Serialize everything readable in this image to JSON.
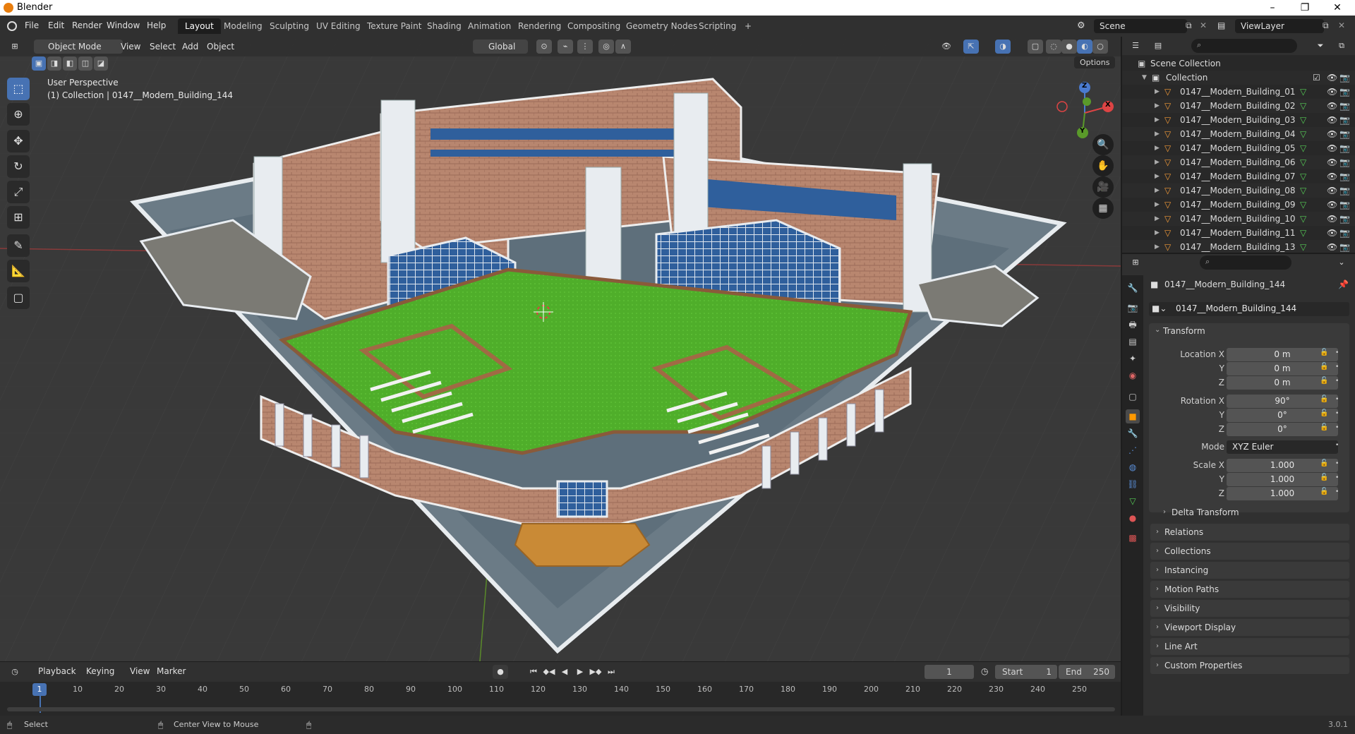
{
  "app": {
    "title": "Blender",
    "version": "3.0.1"
  },
  "menus": [
    "File",
    "Edit",
    "Render",
    "Window",
    "Help"
  ],
  "workspaces": [
    "Layout",
    "Modeling",
    "Sculpting",
    "UV Editing",
    "Texture Paint",
    "Shading",
    "Animation",
    "Rendering",
    "Compositing",
    "Geometry Nodes",
    "Scripting",
    "+"
  ],
  "active_workspace": "Layout",
  "scene": {
    "name": "Scene",
    "view_layer": "ViewLayer"
  },
  "viewport": {
    "mode": "Object Mode",
    "menus": [
      "View",
      "Select",
      "Add",
      "Object"
    ],
    "orientation": "Global",
    "options_label": "Options",
    "overlay_title": "User Perspective",
    "overlay_subtitle": "(1) Collection | 0147__Modern_Building_144",
    "axes": {
      "x": "X",
      "y": "Y",
      "z": "Z"
    }
  },
  "outliner": {
    "scene_collection": "Scene Collection",
    "collection": "Collection",
    "items": [
      "0147__Modern_Building_01",
      "0147__Modern_Building_02",
      "0147__Modern_Building_03",
      "0147__Modern_Building_04",
      "0147__Modern_Building_05",
      "0147__Modern_Building_06",
      "0147__Modern_Building_07",
      "0147__Modern_Building_08",
      "0147__Modern_Building_09",
      "0147__Modern_Building_10",
      "0147__Modern_Building_11",
      "0147__Modern_Building_13"
    ]
  },
  "properties": {
    "object_name": "0147__Modern_Building_144",
    "object_field": "0147__Modern_Building_144",
    "transform_label": "Transform",
    "location": {
      "label": "Location X",
      "x": "0 m",
      "y": "0 m",
      "z": "0 m"
    },
    "rotation": {
      "label": "Rotation X",
      "x": "90°",
      "y": "0°",
      "z": "0°"
    },
    "mode": {
      "label": "Mode",
      "value": "XYZ Euler"
    },
    "scale": {
      "label": "Scale X",
      "x": "1.000",
      "y": "1.000",
      "z": "1.000"
    },
    "axis_y": "Y",
    "axis_z": "Z",
    "delta_transform": "Delta Transform",
    "panels": [
      "Relations",
      "Collections",
      "Instancing",
      "Motion Paths",
      "Visibility",
      "Viewport Display",
      "Line Art",
      "Custom Properties"
    ]
  },
  "timeline": {
    "menus": [
      "Playback",
      "Keying",
      "View",
      "Marker"
    ],
    "current_frame": "1",
    "start_label": "Start",
    "start": "1",
    "end_label": "End",
    "end": "250",
    "ruler": [
      "10",
      "20",
      "30",
      "40",
      "50",
      "60",
      "70",
      "80",
      "90",
      "100",
      "110",
      "120",
      "130",
      "140",
      "150",
      "160",
      "170",
      "180",
      "190",
      "200",
      "210",
      "220",
      "230",
      "240",
      "250"
    ],
    "playhead": "1"
  },
  "statusbar": {
    "left": "Select",
    "middle": "Center View to Mouse"
  },
  "colors": {
    "accent": "#4772b3",
    "grass": "#4fae2a",
    "brick": "#b8866f",
    "window_blue": "#2f5f9c",
    "concrete": "#6b7b86"
  }
}
